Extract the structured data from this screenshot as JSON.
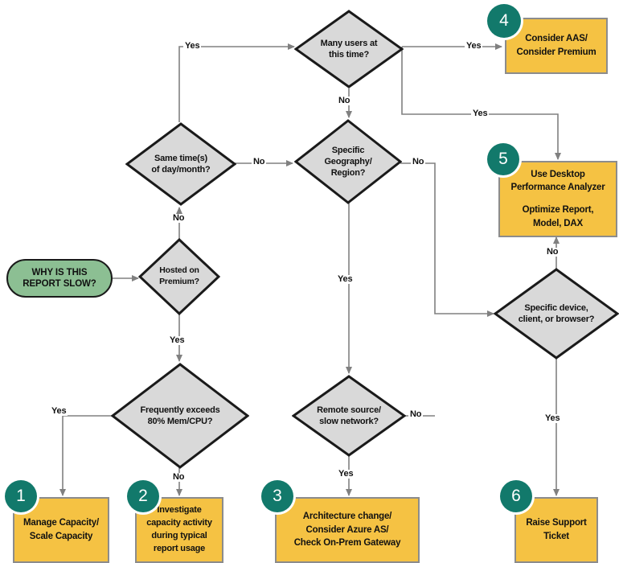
{
  "diagram": {
    "title": "Why is this report slow? troubleshooting flowchart",
    "colors": {
      "start_fill": "#8cbf93",
      "decision_fill": "#d9d9d9",
      "decision_stroke": "#1a1a1a",
      "action_fill": "#f5c243",
      "action_stroke": "#8c8c8c",
      "badge_fill": "#12796b",
      "badge_text": "#ffffff",
      "edge_stroke": "#808080",
      "text": "#111111"
    }
  },
  "start": {
    "line1": "WHY IS THIS",
    "line2": "REPORT SLOW?"
  },
  "decisions": [
    {
      "id": "many-users",
      "line1": "Many users at",
      "line2": "this time?",
      "line3": ""
    },
    {
      "id": "same-times",
      "line1": "Same time(s)",
      "line2": "of day/month?",
      "line3": ""
    },
    {
      "id": "specific-geography",
      "line1": "Specific",
      "line2": "Geography/",
      "line3": "Region?"
    },
    {
      "id": "hosted-on-premium",
      "line1": "Hosted on",
      "line2": "Premium?",
      "line3": ""
    },
    {
      "id": "frequently-exceeds",
      "line1": "Frequently exceeds",
      "line2": "80% Mem/CPU?",
      "line3": ""
    },
    {
      "id": "remote-source",
      "line1": "Remote source/",
      "line2": "slow network?",
      "line3": ""
    },
    {
      "id": "specific-device",
      "line1": "Specific device,",
      "line2": "client, or browser?",
      "line3": ""
    }
  ],
  "actions": [
    {
      "id": "manage-capacity",
      "number": "1",
      "line1": "Manage Capacity/",
      "line2": "Scale Capacity",
      "line3": "",
      "line4": ""
    },
    {
      "id": "investigate-capacity",
      "number": "2",
      "line1": "Investigate",
      "line2": "capacity activity",
      "line3": "during typical",
      "line4": "report usage"
    },
    {
      "id": "architecture-change",
      "number": "3",
      "line1": "Architecture change/",
      "line2": "Consider Azure AS/",
      "line3": "Check On-Prem Gateway",
      "line4": ""
    },
    {
      "id": "consider-aas",
      "number": "4",
      "line1": "Consider AAS/",
      "line2": "Consider Premium",
      "line3": "",
      "line4": ""
    },
    {
      "id": "use-desktop-performance-analyzer",
      "number": "5",
      "line1": "Use Desktop",
      "line2": "Performance Analyzer",
      "line3": "Optimize Report,",
      "line4": "Model, DAX"
    },
    {
      "id": "raise-support-ticket",
      "number": "6",
      "line1": "Raise Support",
      "line2": "Ticket",
      "line3": "",
      "line4": ""
    }
  ],
  "edge_labels": {
    "same_times_yes": "Yes",
    "same_times_no": "No",
    "many_users_yes": "Yes",
    "many_users_no": "No",
    "geography_yes": "Yes",
    "geography_no": "No",
    "premium_yes": "Yes",
    "premium_no": "No",
    "exceeds_yes": "Yes",
    "exceeds_no": "No",
    "remote_yes": "Yes",
    "remote_no": "No",
    "device_yes": "Yes",
    "device_no": "No",
    "geography_to_desktop_yes": "Yes"
  }
}
